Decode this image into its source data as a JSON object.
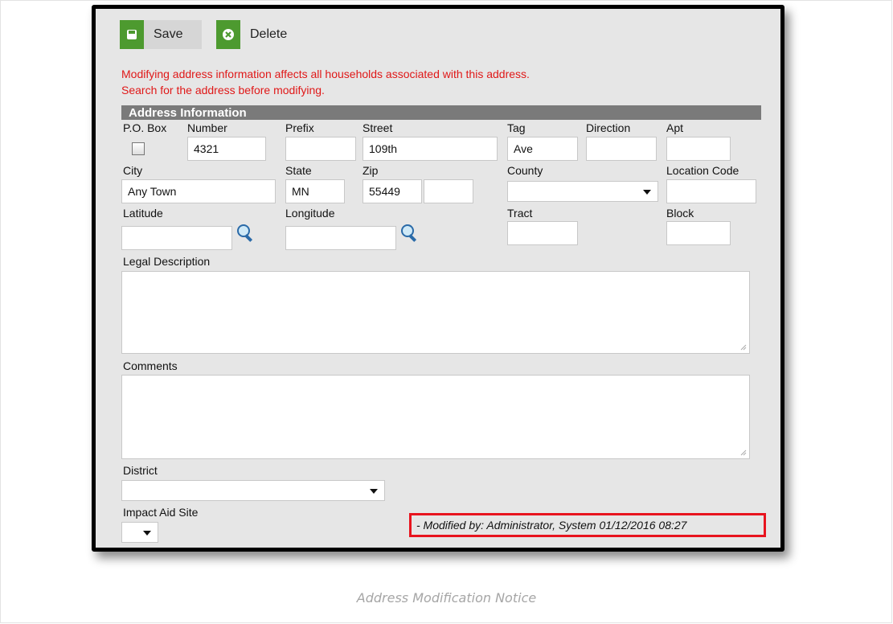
{
  "toolbar": {
    "save_label": "Save",
    "delete_label": "Delete"
  },
  "warning": {
    "line1": "Modifying address information affects all households associated with this address.",
    "line2": "Search for the address before modifying."
  },
  "section_title": "Address Information",
  "labels": {
    "po_box": "P.O. Box",
    "number": "Number",
    "prefix": "Prefix",
    "street": "Street",
    "tag": "Tag",
    "direction": "Direction",
    "apt": "Apt",
    "city": "City",
    "state": "State",
    "zip": "Zip",
    "county": "County",
    "location_code": "Location Code",
    "latitude": "Latitude",
    "longitude": "Longitude",
    "tract": "Tract",
    "block": "Block",
    "legal_description": "Legal Description",
    "comments": "Comments",
    "district": "District",
    "impact_aid_site": "Impact Aid Site"
  },
  "values": {
    "number": "4321",
    "prefix": "",
    "street": "109th",
    "tag": "Ave",
    "direction": "",
    "apt": "",
    "city": "Any Town",
    "state": "MN",
    "zip": "55449",
    "zip_separator": "-",
    "zip_ext": "",
    "county": "",
    "location_code": "",
    "latitude": "",
    "longitude": "",
    "tract": "",
    "block": "",
    "district": "",
    "impact_aid_site": ""
  },
  "modified_by": "- Modified by: Administrator, System 01/12/2016 08:27",
  "caption": "Address Modification Notice",
  "colors": {
    "warning": "#e01818",
    "section_header": "#7a7a7a",
    "highlight_border": "#e8141e",
    "button_icon": "#4d9a2f"
  },
  "icons": [
    "save-icon",
    "delete-icon",
    "magnifier-icon",
    "chevron-down-icon"
  ]
}
